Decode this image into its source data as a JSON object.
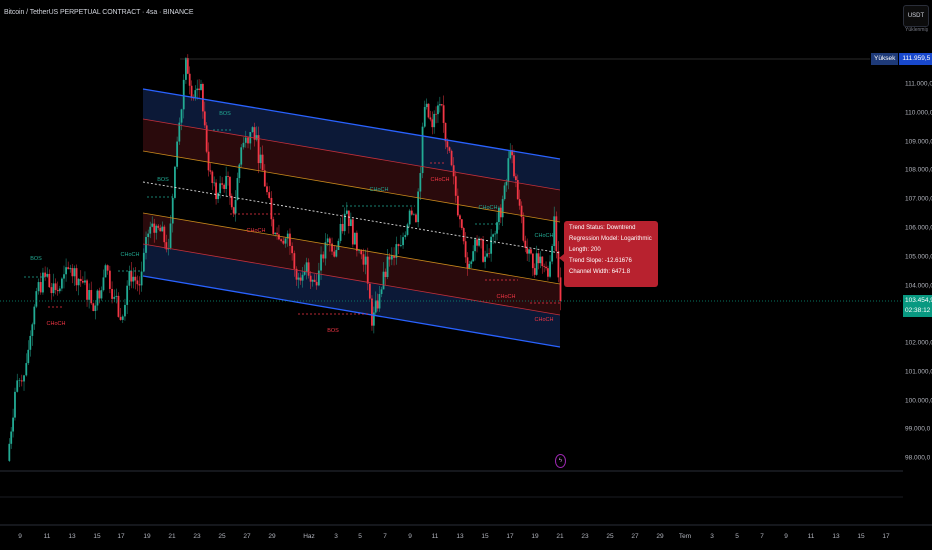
{
  "header": {
    "title": "Bitcoin / TetherUS PERPETUAL CONTRACT · 4sa · BINANCE",
    "currency_button": "USDT",
    "currency_sub": "Yüklenmiş"
  },
  "price_axis": {
    "labels": [
      "111.000,0",
      "110.000,0",
      "109.000,0",
      "108.000,0",
      "107.000,0",
      "106.000,0",
      "105.000,0",
      "104.000,0",
      "102.000,0",
      "101.000,0",
      "100.000,0",
      "99.000,0",
      "98.000,0"
    ],
    "high_label": "Yüksek",
    "high_value": "111.959,5",
    "current_price": "103.454,9",
    "countdown": "02:38:12"
  },
  "time_axis": {
    "labels": [
      "9",
      "11",
      "13",
      "15",
      "17",
      "19",
      "21",
      "23",
      "25",
      "27",
      "29",
      "Haz",
      "3",
      "5",
      "7",
      "9",
      "11",
      "13",
      "15",
      "17",
      "19",
      "21",
      "23",
      "25",
      "27",
      "29",
      "Tem",
      "3",
      "5",
      "7",
      "9",
      "11",
      "13",
      "15",
      "17"
    ]
  },
  "smc_labels": [
    {
      "text": "BOS",
      "color": "#22ab94"
    },
    {
      "text": "CHoCH",
      "color": "#22ab94"
    },
    {
      "text": "CHoCH",
      "color": "#f23645"
    },
    {
      "text": "BOS",
      "color": "#22ab94"
    },
    {
      "text": "BOS",
      "color": "#22ab94"
    },
    {
      "text": "CHoCH",
      "color": "#f23645"
    },
    {
      "text": "CHoCH",
      "color": "#22ab94"
    },
    {
      "text": "BOS",
      "color": "#f23645"
    },
    {
      "text": "CHoCH",
      "color": "#f23645"
    },
    {
      "text": "CHoCH",
      "color": "#22ab94"
    },
    {
      "text": "CHoCH",
      "color": "#22ab94"
    },
    {
      "text": "CHoCH",
      "color": "#f23645"
    },
    {
      "text": "CHoCH",
      "color": "#f23645"
    }
  ],
  "info_box": {
    "lines": [
      "Trend Status: Downtrend",
      "Regression Model: Logarithmic",
      "Length: 200",
      "Trend Slope: -12.61676",
      "Channel Width: 6471.8"
    ]
  },
  "colors": {
    "up": "#22ab94",
    "down": "#f23645",
    "channel": "#2962ff",
    "inner": "#f23645",
    "mid": "#f5a623"
  },
  "chart_data": {
    "type": "candlestick",
    "interval": "4h",
    "x_unit": "days since May 9",
    "keypoints": [
      [
        -1,
        97900
      ],
      [
        -0.4,
        100300
      ],
      [
        0.5,
        101300
      ],
      [
        1.3,
        103800
      ],
      [
        2,
        104300
      ],
      [
        3,
        103800
      ],
      [
        4,
        104600
      ],
      [
        5,
        104100
      ],
      [
        6,
        103300
      ],
      [
        6.8,
        104700
      ],
      [
        7.5,
        103600
      ],
      [
        8,
        102800
      ],
      [
        8.7,
        104500
      ],
      [
        9.5,
        104000
      ],
      [
        10.2,
        105800
      ],
      [
        11,
        106000
      ],
      [
        11.8,
        105300
      ],
      [
        12.5,
        109000
      ],
      [
        13.2,
        111900
      ],
      [
        13.8,
        110500
      ],
      [
        14.4,
        111000
      ],
      [
        15,
        108000
      ],
      [
        15.6,
        107000
      ],
      [
        16.4,
        107800
      ],
      [
        17,
        106500
      ],
      [
        17.6,
        108800
      ],
      [
        18.5,
        109500
      ],
      [
        19.3,
        108000
      ],
      [
        20,
        106300
      ],
      [
        20.6,
        105600
      ],
      [
        21.3,
        105800
      ],
      [
        22,
        104200
      ],
      [
        22.8,
        104800
      ],
      [
        23.6,
        104000
      ],
      [
        24.3,
        105500
      ],
      [
        25,
        105000
      ],
      [
        26,
        106600
      ],
      [
        26.8,
        105200
      ],
      [
        27.5,
        105000
      ],
      [
        28,
        102600
      ],
      [
        28.6,
        103700
      ],
      [
        29.4,
        104900
      ],
      [
        30.3,
        105400
      ],
      [
        31,
        106600
      ],
      [
        31.5,
        106200
      ],
      [
        32.2,
        110200
      ],
      [
        32.8,
        109500
      ],
      [
        33.4,
        110300
      ],
      [
        34,
        108800
      ],
      [
        35,
        106300
      ],
      [
        35.6,
        104600
      ],
      [
        36.2,
        105600
      ],
      [
        37,
        105000
      ],
      [
        37.8,
        105800
      ],
      [
        38.4,
        107000
      ],
      [
        39,
        108700
      ],
      [
        39.6,
        107000
      ],
      [
        40.2,
        105300
      ],
      [
        40.8,
        104600
      ],
      [
        41.4,
        105000
      ],
      [
        42,
        104300
      ],
      [
        42.5,
        106400
      ],
      [
        43,
        103455
      ]
    ],
    "ylim": [
      97500,
      112500
    ]
  }
}
